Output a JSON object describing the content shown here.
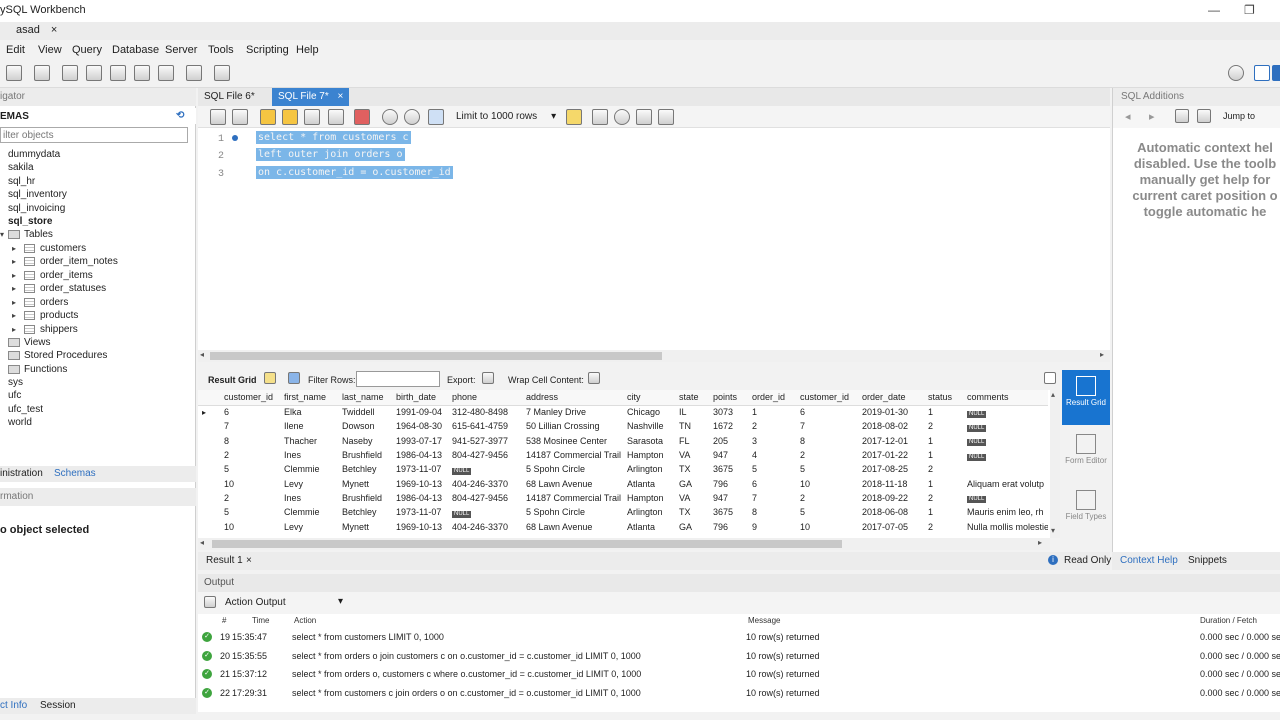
{
  "window": {
    "title": "ySQL Workbench",
    "minimize": "—",
    "maximize": "❐"
  },
  "connection_tab": {
    "label": "asad",
    "close": "×"
  },
  "menu": [
    "Edit",
    "View",
    "Query",
    "Database",
    "Server",
    "Tools",
    "Scripting",
    "Help"
  ],
  "navigator": {
    "header": "igator",
    "section": "EMAS",
    "filter_placeholder": "ilter objects",
    "schemas": [
      "dummydata",
      "sakila",
      "sql_hr",
      "sql_inventory",
      "sql_invoicing",
      "sql_store"
    ],
    "sql_store_children": {
      "tables_label": "Tables",
      "tables": [
        "customers",
        "order_item_notes",
        "order_items",
        "order_statuses",
        "orders",
        "products",
        "shippers"
      ],
      "views": "Views",
      "procs": "Stored Procedures",
      "functions": "Functions"
    },
    "other_schemas": [
      "sys",
      "ufc",
      "ufc_test",
      "world"
    ],
    "tabs": {
      "admin": "inistration",
      "schemas": "Schemas"
    }
  },
  "info": {
    "header": "rmation",
    "no_object": "o object selected",
    "tabs": {
      "obj": "ct Info",
      "session": "Session"
    }
  },
  "editor": {
    "tabs": [
      {
        "label": "SQL File 6*"
      },
      {
        "label": "SQL File 7*",
        "close": "×"
      }
    ],
    "limit": "Limit to 1000 rows",
    "lines": [
      {
        "num": "1",
        "text": "select * from customers c"
      },
      {
        "num": "2",
        "text": "left outer join orders o"
      },
      {
        "num": "3",
        "text": "on c.customer_id = o.customer_id"
      }
    ]
  },
  "result_toolbar": {
    "result_grid": "Result Grid",
    "filter_rows": "Filter Rows:",
    "export": "Export:",
    "wrap": "Wrap Cell Content:"
  },
  "grid": {
    "columns": [
      "customer_id",
      "first_name",
      "last_name",
      "birth_date",
      "phone",
      "address",
      "city",
      "state",
      "points",
      "order_id",
      "customer_id",
      "order_date",
      "status",
      "comments"
    ],
    "rows": [
      [
        "6",
        "Elka",
        "Twiddell",
        "1991-09-04",
        "312-480-8498",
        "7 Manley Drive",
        "Chicago",
        "IL",
        "3073",
        "1",
        "6",
        "2019-01-30",
        "1",
        "NULL"
      ],
      [
        "7",
        "Ilene",
        "Dowson",
        "1964-08-30",
        "615-641-4759",
        "50 Lillian Crossing",
        "Nashville",
        "TN",
        "1672",
        "2",
        "7",
        "2018-08-02",
        "2",
        "NULL"
      ],
      [
        "8",
        "Thacher",
        "Naseby",
        "1993-07-17",
        "941-527-3977",
        "538 Mosinee Center",
        "Sarasota",
        "FL",
        "205",
        "3",
        "8",
        "2017-12-01",
        "1",
        "NULL"
      ],
      [
        "2",
        "Ines",
        "Brushfield",
        "1986-04-13",
        "804-427-9456",
        "14187 Commercial Trail",
        "Hampton",
        "VA",
        "947",
        "4",
        "2",
        "2017-01-22",
        "1",
        "NULL"
      ],
      [
        "5",
        "Clemmie",
        "Betchley",
        "1973-11-07",
        "NULL",
        "5 Spohn Circle",
        "Arlington",
        "TX",
        "3675",
        "5",
        "5",
        "2017-08-25",
        "2",
        ""
      ],
      [
        "10",
        "Levy",
        "Mynett",
        "1969-10-13",
        "404-246-3370",
        "68 Lawn Avenue",
        "Atlanta",
        "GA",
        "796",
        "6",
        "10",
        "2018-11-18",
        "1",
        "Aliquam erat volutp"
      ],
      [
        "2",
        "Ines",
        "Brushfield",
        "1986-04-13",
        "804-427-9456",
        "14187 Commercial Trail",
        "Hampton",
        "VA",
        "947",
        "7",
        "2",
        "2018-09-22",
        "2",
        "NULL"
      ],
      [
        "5",
        "Clemmie",
        "Betchley",
        "1973-11-07",
        "NULL",
        "5 Spohn Circle",
        "Arlington",
        "TX",
        "3675",
        "8",
        "5",
        "2018-06-08",
        "1",
        "Mauris enim leo, rh"
      ],
      [
        "10",
        "Levy",
        "Mynett",
        "1969-10-13",
        "404-246-3370",
        "68 Lawn Avenue",
        "Atlanta",
        "GA",
        "796",
        "9",
        "10",
        "2017-07-05",
        "2",
        "Nulla mollis molestie"
      ]
    ]
  },
  "result_side": {
    "grid": "Result Grid",
    "form": "Form Editor",
    "types": "Field Types"
  },
  "result_tabs": {
    "result": "Result 1",
    "close": "×",
    "readonly": "Read Only"
  },
  "output": {
    "header": "Output",
    "selector": "Action Output",
    "columns": {
      "num": "#",
      "time": "Time",
      "action": "Action",
      "message": "Message",
      "duration": "Duration / Fetch"
    },
    "rows": [
      {
        "num": "19",
        "time": "15:35:47",
        "action": "select * from customers LIMIT 0, 1000",
        "message": "10 row(s) returned",
        "duration": "0.000 sec / 0.000 se"
      },
      {
        "num": "20",
        "time": "15:35:55",
        "action": "select * from orders  o join customers  c on o.customer_id = c.customer_id LIMIT 0, 1000",
        "message": "10 row(s) returned",
        "duration": "0.000 sec / 0.000 se"
      },
      {
        "num": "21",
        "time": "15:37:12",
        "action": "select * from orders  o,  customers  c where o.customer_id = c.customer_id LIMIT 0, 1000",
        "message": "10 row(s) returned",
        "duration": "0.000 sec / 0.000 se"
      },
      {
        "num": "22",
        "time": "17:29:31",
        "action": "select * from customers c join orders o  on c.customer_id = o.customer_id LIMIT 0, 1000",
        "message": "10 row(s) returned",
        "duration": "0.000 sec / 0.000 se"
      }
    ]
  },
  "sql_additions": {
    "header": "SQL Additions",
    "jump": "Jump to",
    "help_lines": [
      "Automatic context hel",
      "disabled. Use the toolb",
      "manually get help for",
      "current caret position o",
      "toggle automatic he"
    ],
    "tabs": {
      "context": "Context Help",
      "snippets": "Snippets"
    }
  },
  "colors": {
    "accent": "#1874d0",
    "selection": "#7bb6e8",
    "ok": "#3ea43e"
  }
}
